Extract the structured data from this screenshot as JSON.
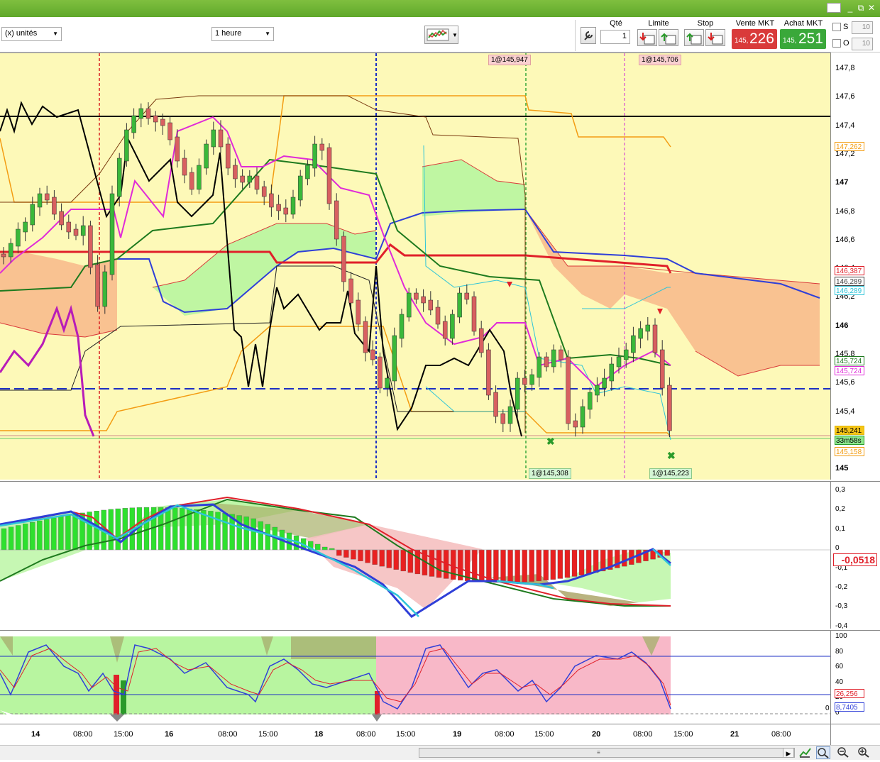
{
  "window": {
    "min": "_",
    "restore": "⧉",
    "close": "✕"
  },
  "toolbar": {
    "units_select": "(x) unités",
    "timeframe_select": "1 heure",
    "order": {
      "qty_header": "Qté",
      "qty_value": "1",
      "limit_header": "Limite",
      "stop_header": "Stop",
      "sell_header": "Vente MKT",
      "buy_header": "Achat MKT",
      "sell_small": "145,",
      "sell_big": "226",
      "buy_small": "145,",
      "buy_big": "251",
      "sell_color": "#d93a3a",
      "buy_color": "#3aa83a"
    },
    "s_label": "S",
    "o_label": "O",
    "s_value": "10",
    "o_value": "10"
  },
  "price_axis": {
    "ticks": [
      "147,8",
      "147,6",
      "147,4",
      "147,2",
      "147",
      "146,8",
      "146,6",
      "146,4",
      "146,2",
      "146",
      "145,8",
      "145,6",
      "145,4",
      "145,2",
      "145"
    ],
    "tags": [
      {
        "text": "147,262",
        "color": "#f39c12"
      },
      {
        "text": "146,387",
        "color": "#e0202a"
      },
      {
        "text": "146,289",
        "color": "#444444"
      },
      {
        "text": "146,289",
        "color": "#2ec4d8"
      },
      {
        "text": "145,724",
        "color": "#1e7a1e"
      },
      {
        "text": "145,724",
        "color": "#e02ad8"
      },
      {
        "text": "145,241",
        "color": "#e6b800"
      },
      {
        "text": "33m58s",
        "color": "#2a9a2a"
      },
      {
        "text": "145,158",
        "color": "#f39c12"
      }
    ]
  },
  "trades": {
    "top_left": "1@145,947",
    "top_right": "1@145,706",
    "bottom_left": "1@145,308",
    "bottom_right": "1@145,223"
  },
  "macd_axis": {
    "ticks": [
      "0,3",
      "0,2",
      "0,1",
      "0",
      "-0,1",
      "-0,2",
      "-0,3",
      "-0,4"
    ],
    "current": "-0,0518"
  },
  "stoch_axis": {
    "ticks": [
      "100",
      "80",
      "60",
      "40",
      "20",
      "0"
    ],
    "zero_label": "0",
    "tag_red": "26,256",
    "tag_blue": "8,7405"
  },
  "date_axis": [
    {
      "label": "14",
      "bold": true
    },
    {
      "label": "08:00",
      "bold": false
    },
    {
      "label": "15:00",
      "bold": false
    },
    {
      "label": "16",
      "bold": true
    },
    {
      "label": "08:00",
      "bold": false
    },
    {
      "label": "15:00",
      "bold": false
    },
    {
      "label": "18",
      "bold": true
    },
    {
      "label": "08:00",
      "bold": false
    },
    {
      "label": "15:00",
      "bold": false
    },
    {
      "label": "19",
      "bold": true
    },
    {
      "label": "08:00",
      "bold": false
    },
    {
      "label": "15:00",
      "bold": false
    },
    {
      "label": "20",
      "bold": true
    },
    {
      "label": "08:00",
      "bold": false
    },
    {
      "label": "15:00",
      "bold": false
    },
    {
      "label": "21",
      "bold": true
    },
    {
      "label": "08:00",
      "bold": false
    }
  ],
  "icons": [
    "wrench-icon",
    "chart-type-icon",
    "zoom-move-icon",
    "zoom-out-icon",
    "zoom-in-icon",
    "scroll-right-icon"
  ]
}
